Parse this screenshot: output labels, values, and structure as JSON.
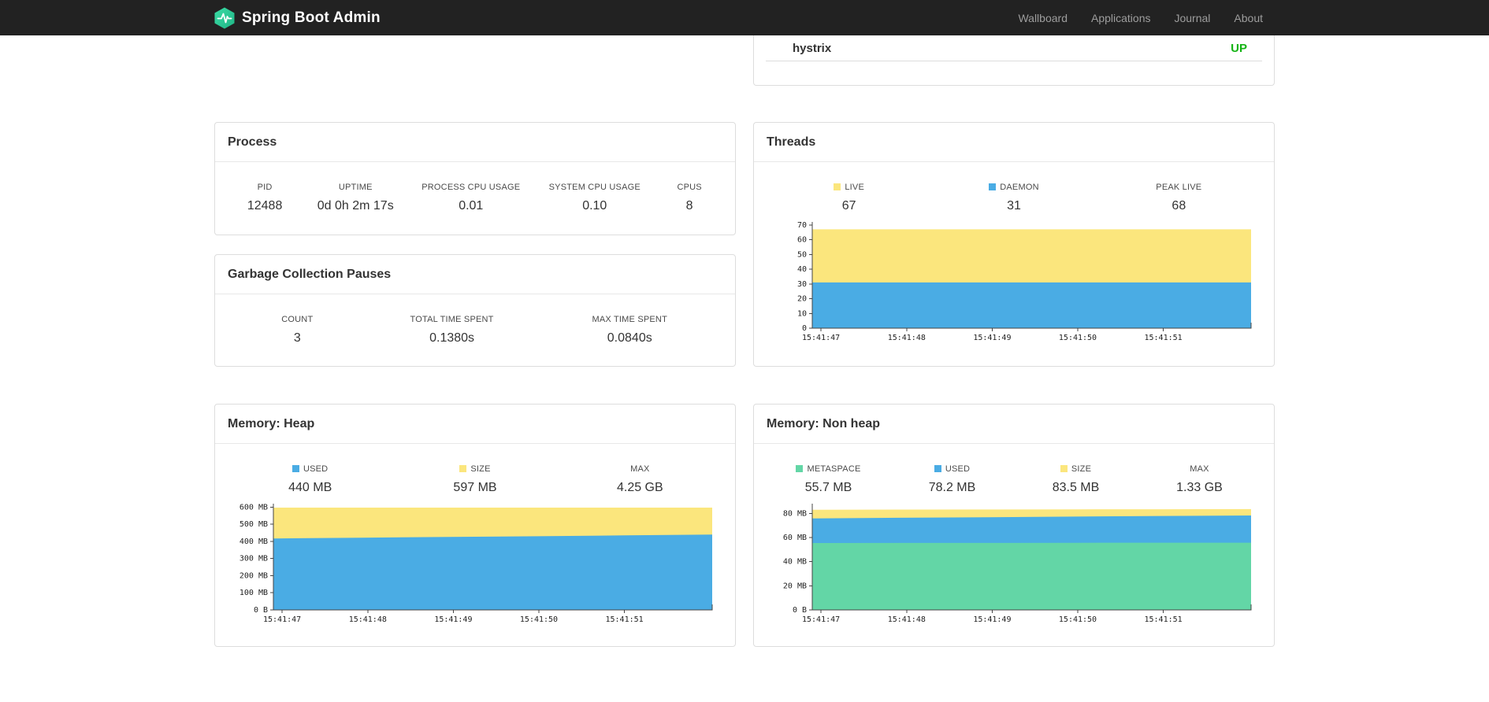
{
  "navbar": {
    "brand": "Spring Boot Admin",
    "logo_color": "#2fd3a2",
    "links": [
      {
        "label": "Wallboard"
      },
      {
        "label": "Applications"
      },
      {
        "label": "Journal"
      },
      {
        "label": "About"
      }
    ]
  },
  "service_panel": {
    "rows": [
      {
        "name": "hystrix",
        "status": "UP",
        "status_color": "#14b414"
      }
    ]
  },
  "process": {
    "title": "Process",
    "stats": [
      {
        "label": "PID",
        "value": "12488"
      },
      {
        "label": "UPTIME",
        "value": "0d 0h 2m 17s"
      },
      {
        "label": "PROCESS CPU USAGE",
        "value": "0.01"
      },
      {
        "label": "SYSTEM CPU USAGE",
        "value": "0.10"
      },
      {
        "label": "CPUS",
        "value": "8"
      }
    ]
  },
  "gc": {
    "title": "Garbage Collection Pauses",
    "stats": [
      {
        "label": "COUNT",
        "value": "3"
      },
      {
        "label": "TOTAL TIME SPENT",
        "value": "0.1380s"
      },
      {
        "label": "MAX TIME SPENT",
        "value": "0.0840s"
      }
    ]
  },
  "threads": {
    "title": "Threads",
    "stats": [
      {
        "label": "LIVE",
        "value": "67",
        "swatch": "#fbe67d"
      },
      {
        "label": "DAEMON",
        "value": "31",
        "swatch": "#4aace4"
      },
      {
        "label": "PEAK LIVE",
        "value": "68",
        "swatch": null
      }
    ]
  },
  "heap": {
    "title": "Memory: Heap",
    "stats": [
      {
        "label": "USED",
        "value": "440 MB",
        "swatch": "#4aace4"
      },
      {
        "label": "SIZE",
        "value": "597 MB",
        "swatch": "#fbe67d"
      },
      {
        "label": "MAX",
        "value": "4.25 GB",
        "swatch": null
      }
    ]
  },
  "nonheap": {
    "title": "Memory: Non heap",
    "stats": [
      {
        "label": "METASPACE",
        "value": "55.7 MB",
        "swatch": "#63d6a6"
      },
      {
        "label": "USED",
        "value": "78.2 MB",
        "swatch": "#4aace4"
      },
      {
        "label": "SIZE",
        "value": "83.5 MB",
        "swatch": "#fbe67d"
      },
      {
        "label": "MAX",
        "value": "1.33 GB",
        "swatch": null
      }
    ]
  },
  "chart_data": [
    {
      "name": "threads",
      "type": "area",
      "title": "Threads",
      "legend_position": "top",
      "grid": false,
      "x": [
        "15:41:47",
        "15:41:48",
        "15:41:49",
        "15:41:50",
        "15:41:51"
      ],
      "y_max": 72,
      "y_ticks": {
        "values": [
          0,
          10,
          20,
          30,
          40,
          50,
          60,
          70
        ],
        "labels": [
          "0",
          "10",
          "20",
          "30",
          "40",
          "50",
          "60",
          "70"
        ]
      },
      "series": [
        {
          "name": "LIVE",
          "color": "#fbe67d",
          "values": [
            67,
            67,
            67,
            67,
            67,
            67
          ]
        },
        {
          "name": "DAEMON",
          "color": "#4aace4",
          "values": [
            31,
            31,
            31,
            31,
            31,
            31
          ]
        }
      ]
    },
    {
      "name": "heap",
      "type": "area",
      "title": "Memory: Heap",
      "legend_position": "top",
      "grid": false,
      "x": [
        "15:41:47",
        "15:41:48",
        "15:41:49",
        "15:41:50",
        "15:41:51"
      ],
      "y_max": 620,
      "y_ticks": {
        "values": [
          0,
          100,
          200,
          300,
          400,
          500,
          600
        ],
        "labels": [
          "0 B",
          "100 MB",
          "200 MB",
          "300 MB",
          "400 MB",
          "500 MB",
          "600 MB"
        ]
      },
      "series": [
        {
          "name": "SIZE",
          "color": "#fbe67d",
          "values": [
            597,
            597,
            597,
            597,
            597,
            597
          ]
        },
        {
          "name": "USED",
          "color": "#4aace4",
          "values": [
            417,
            421,
            426,
            430,
            435,
            440
          ]
        }
      ]
    },
    {
      "name": "nonheap",
      "type": "area",
      "title": "Memory: Non heap",
      "legend_position": "top",
      "grid": false,
      "x": [
        "15:41:47",
        "15:41:48",
        "15:41:49",
        "15:41:50",
        "15:41:51"
      ],
      "y_max": 88,
      "y_ticks": {
        "values": [
          0,
          20,
          40,
          60,
          80
        ],
        "labels": [
          "0 B",
          "20 MB",
          "40 MB",
          "60 MB",
          "80 MB"
        ]
      },
      "series": [
        {
          "name": "SIZE",
          "color": "#fbe67d",
          "values": [
            83.0,
            83.1,
            83.2,
            83.3,
            83.4,
            83.5
          ]
        },
        {
          "name": "USED",
          "color": "#4aace4",
          "values": [
            75.8,
            76.3,
            76.8,
            77.3,
            77.8,
            78.2
          ]
        },
        {
          "name": "METASPACE",
          "color": "#63d6a6",
          "values": [
            55.4,
            55.5,
            55.5,
            55.6,
            55.7,
            55.7
          ]
        }
      ]
    }
  ]
}
